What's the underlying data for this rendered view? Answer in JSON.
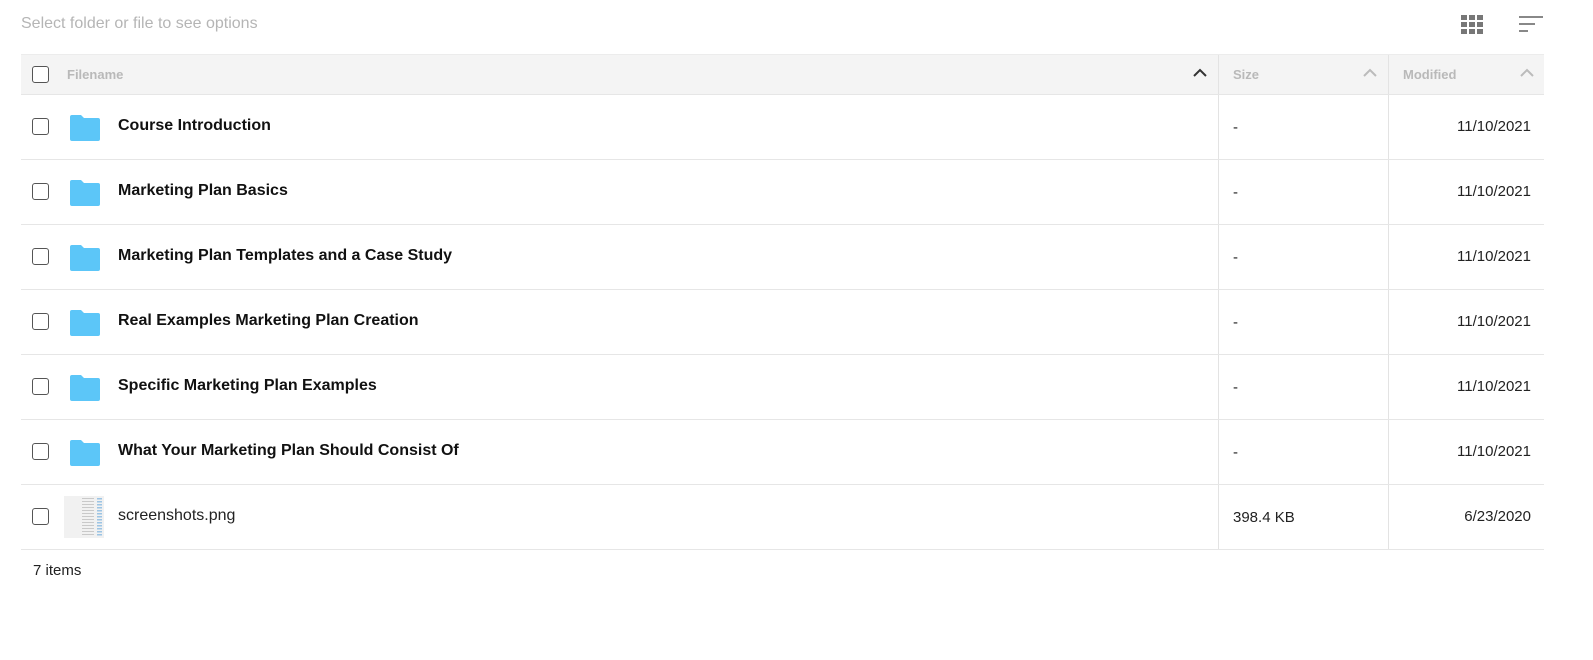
{
  "toolbar": {
    "hint": "Select folder or file to see options",
    "icons": [
      "grid-view-icon",
      "sort-icon"
    ]
  },
  "table": {
    "columns": {
      "filename": "Filename",
      "size": "Size",
      "modified": "Modified"
    },
    "rows": [
      {
        "type": "folder",
        "name": "Course Introduction",
        "size": "-",
        "modified": "11/10/2021"
      },
      {
        "type": "folder",
        "name": "Marketing Plan Basics",
        "size": "-",
        "modified": "11/10/2021"
      },
      {
        "type": "folder",
        "name": "Marketing Plan Templates and a Case Study",
        "size": "-",
        "modified": "11/10/2021"
      },
      {
        "type": "folder",
        "name": "Real Examples Marketing Plan Creation",
        "size": "-",
        "modified": "11/10/2021"
      },
      {
        "type": "folder",
        "name": "Specific Marketing Plan Examples",
        "size": "-",
        "modified": "11/10/2021"
      },
      {
        "type": "folder",
        "name": "What Your Marketing Plan Should Consist Of",
        "size": "-",
        "modified": "11/10/2021"
      },
      {
        "type": "file",
        "name": "screenshots.png",
        "size": "398.4 KB",
        "modified": "6/23/2020"
      }
    ]
  },
  "footer": {
    "count": "7 items"
  },
  "colors": {
    "folder": "#5cc6f8",
    "header_bg": "#f4f4f4",
    "hint_text": "#b5b5b5"
  }
}
